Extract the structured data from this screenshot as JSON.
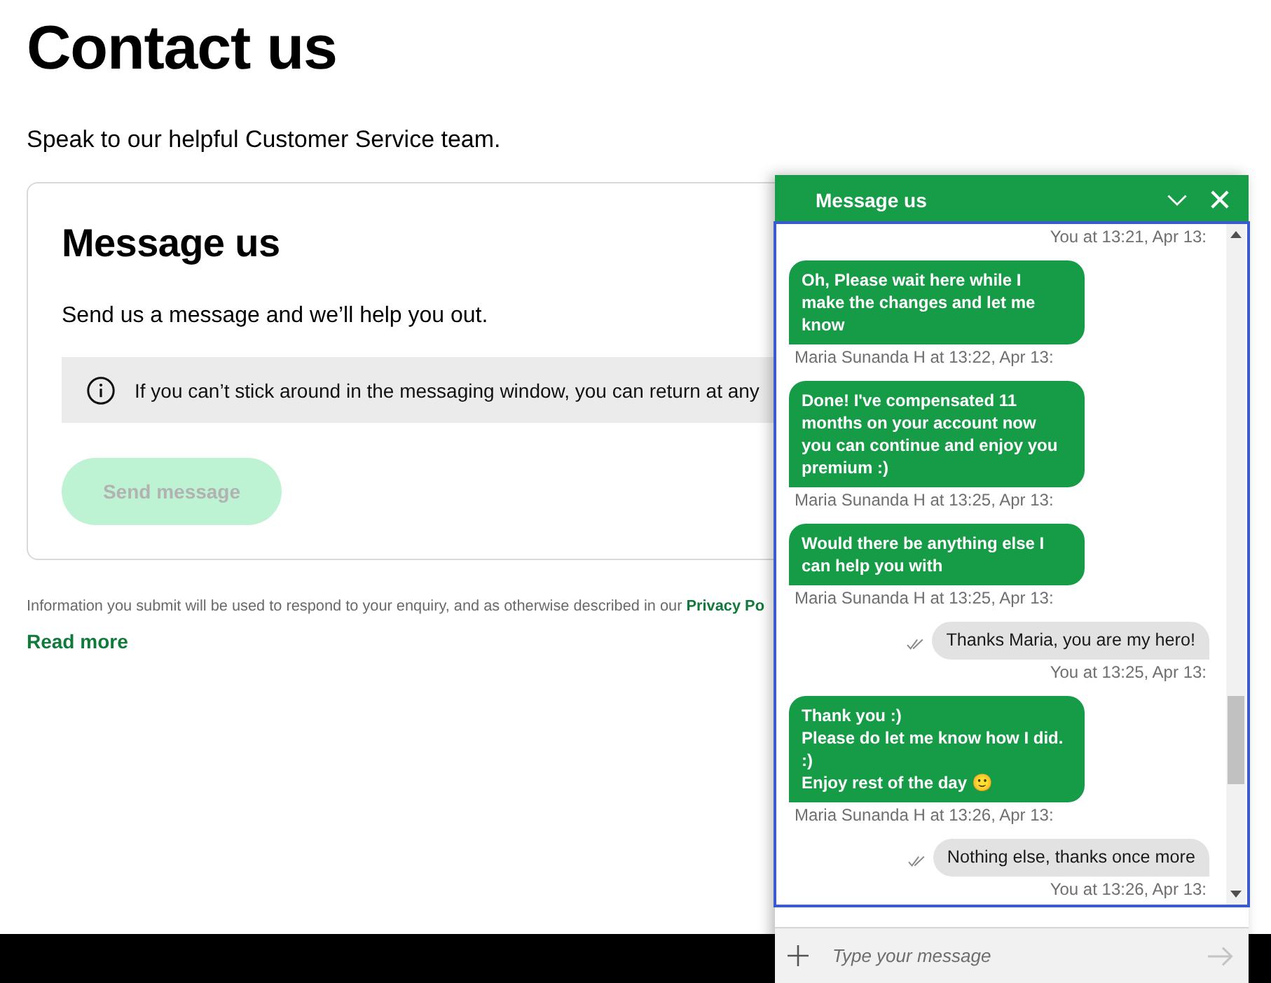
{
  "page": {
    "title": "Contact us",
    "subtitle": "Speak to our helpful Customer Service team."
  },
  "card": {
    "title": "Message us",
    "description": "Send us a message and we’ll help you out.",
    "notice": "If you can’t stick around in the messaging window, you can return at any",
    "button": {
      "label": "Send message",
      "disabled": true
    }
  },
  "disclaimer": {
    "text": "Information you submit will be used to respond to your enquiry, and as otherwise described in our",
    "link": "Privacy Po"
  },
  "read_more": "Read more",
  "chat": {
    "title": "Message us",
    "messages": [
      {
        "kind": "user",
        "meta": "You at 13:21, Apr 13:"
      },
      {
        "kind": "agent",
        "text": "Oh, Please wait here while I\nmake the changes and let me\nknow",
        "meta": "Maria Sunanda H at 13:22, Apr 13:"
      },
      {
        "kind": "agent",
        "text": "Done! I've compensated 11\nmonths on your account now\nyou can continue and enjoy you\npremium :)",
        "meta": "Maria Sunanda H at 13:25, Apr 13:"
      },
      {
        "kind": "agent",
        "text": "Would there be anything else I\ncan help you with",
        "meta": "Maria Sunanda H at 13:25, Apr 13:"
      },
      {
        "kind": "user",
        "text": "Thanks Maria, you are my hero!",
        "read": true,
        "meta": "You at 13:25, Apr 13:"
      },
      {
        "kind": "agent",
        "text": "Thank you :)\nPlease do let me know how I did.\n:)\nEnjoy rest of the day 🙂",
        "meta": "Maria Sunanda H at 13:26, Apr 13:"
      },
      {
        "kind": "user",
        "text": "Nothing else, thanks once more",
        "read": true,
        "meta": "You at 13:26, Apr 13:"
      }
    ],
    "composer": {
      "placeholder": "Type your message"
    }
  }
}
